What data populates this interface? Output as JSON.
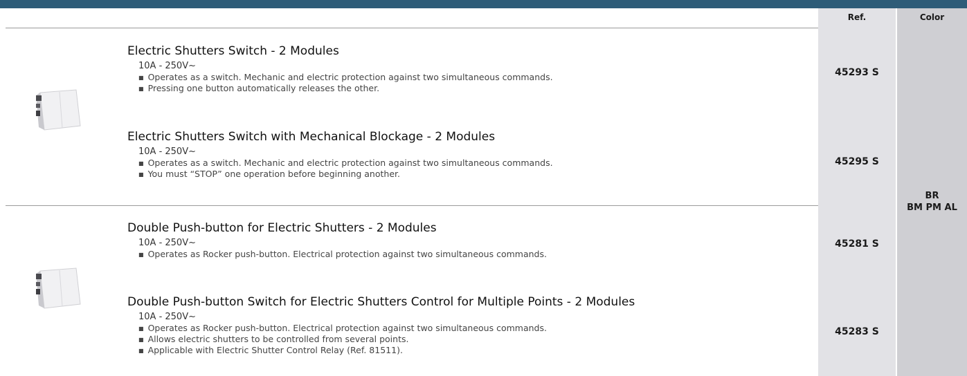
{
  "table_header": {
    "ref": "Ref.",
    "color": "Color"
  },
  "groups": [
    {
      "image_name": "2-module-switch-photo",
      "items": [
        {
          "title": "Electric Shutters Switch - 2 Modules",
          "spec": "10A - 250V~",
          "bullets": [
            "Operates as a switch. Mechanic and electric protection against two simultaneous commands.",
            "Pressing one button automatically releases the other."
          ],
          "ref": "45293 S"
        },
        {
          "title": "Electric Shutters Switch with Mechanical Blockage - 2 Modules",
          "spec": "10A - 250V~",
          "bullets": [
            "Operates as a switch. Mechanic and electric protection against two simultaneous commands.",
            "You must “STOP” one operation before beginning another."
          ],
          "ref": "45295 S"
        }
      ]
    },
    {
      "image_name": "2-module-pushbutton-photo",
      "items": [
        {
          "title": "Double Push-button for Electric Shutters - 2 Modules",
          "spec": "10A - 250V~",
          "bullets": [
            "Operates as Rocker push-button. Electrical protection against two simultaneous commands."
          ],
          "ref": "45281 S"
        },
        {
          "title": "Double Push-button Switch for Electric Shutters Control for Multiple Points - 2 Modules",
          "spec": "10A - 250V~",
          "bullets": [
            "Operates as Rocker push-button. Electrical protection against two simultaneous commands.",
            "Allows electric shutters to be controlled from several points.",
            "Applicable with Electric Shutter Control Relay (Ref. 81511)."
          ],
          "ref": "45283 S"
        }
      ]
    }
  ],
  "color_codes": {
    "line1": "BR",
    "line2": "BM PM AL"
  },
  "colors": {
    "header_bar": "#2e5c78",
    "ref_column": "#e2e2e6",
    "color_column": "#cfcfd3"
  }
}
